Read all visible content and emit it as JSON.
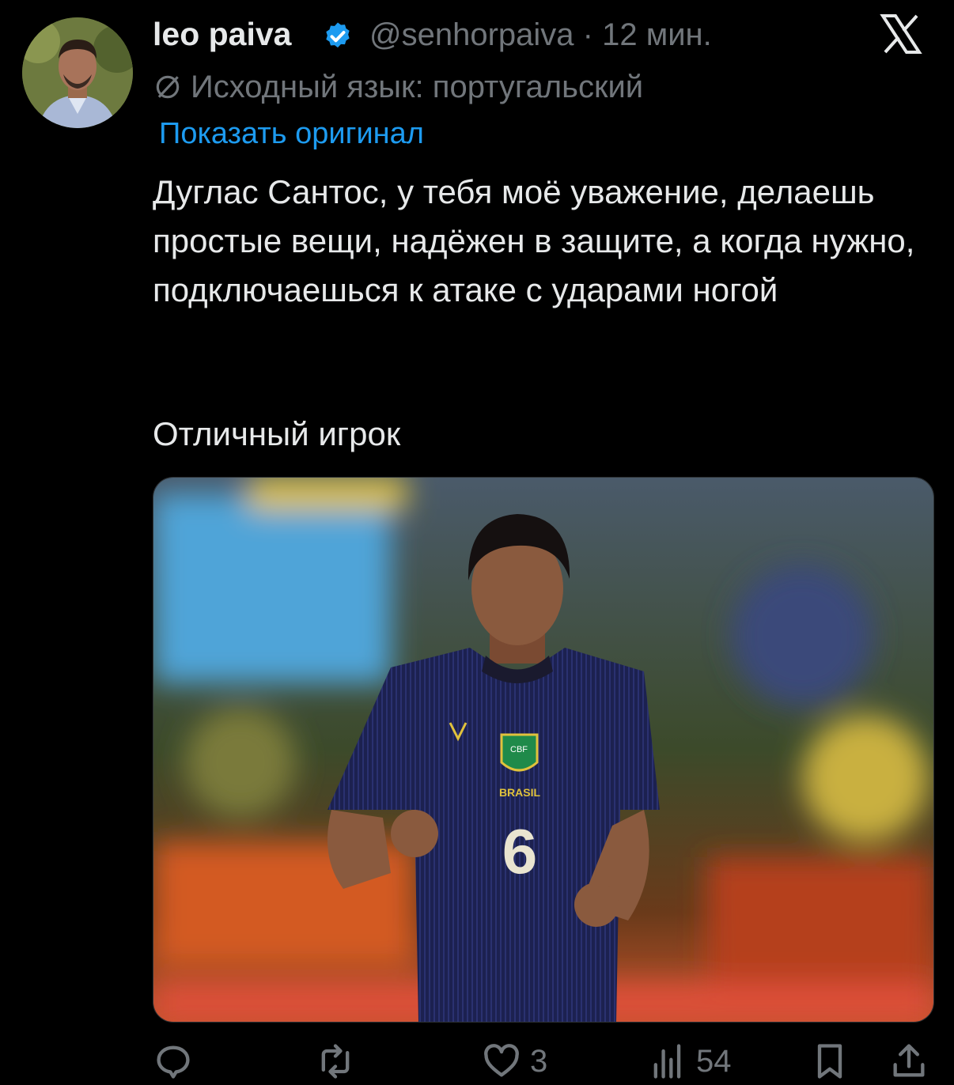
{
  "tweet": {
    "author_name": "leo paiva",
    "handle_time": "@senhorpaiva · 12 мин.",
    "source_language": "Исходный язык: португальский",
    "show_original": "Показать оригинал",
    "text_main": "Дуглас Сантос, у тебя моё уважение, делаешь простые вещи, надёжен в защите, а когда нужно, подключаешься к атаке с ударами ногой",
    "text_secondary": "Отличный игрок",
    "media": {
      "jersey_crest": "CBF",
      "jersey_text": "BRASIL",
      "jersey_number": "6"
    },
    "actions": {
      "likes": "3",
      "views": "54"
    }
  },
  "colors": {
    "background": "#000000",
    "text": "#e7e9ea",
    "muted": "#71767b",
    "link": "#1d9bf0",
    "verified": "#1d9bf0"
  },
  "icons": [
    "verified-badge-icon",
    "x-logo-icon",
    "translate-icon",
    "reply-icon",
    "retweet-icon",
    "like-icon",
    "views-icon",
    "bookmark-icon",
    "share-icon"
  ]
}
